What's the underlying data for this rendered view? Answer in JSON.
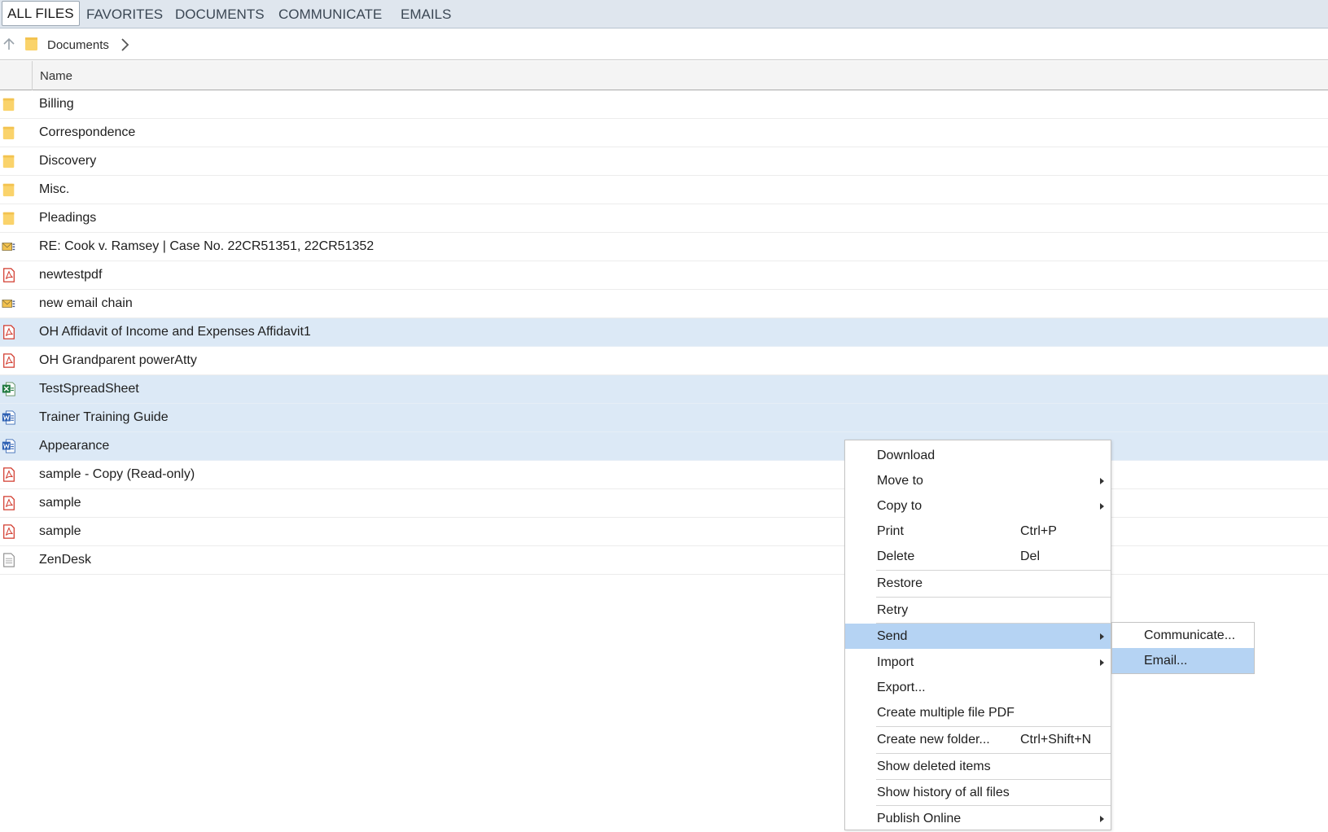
{
  "tabs": [
    {
      "label": "ALL FILES",
      "active": true
    },
    {
      "label": "FAVORITES"
    },
    {
      "label": "DOCUMENTS"
    },
    {
      "label": "COMMUNICATE"
    },
    {
      "label": "EMAILS"
    }
  ],
  "breadcrumb": {
    "folder": "Documents"
  },
  "columns": {
    "name": "Name"
  },
  "files": [
    {
      "name": "Billing",
      "icon": "folder-icon",
      "selected": false
    },
    {
      "name": "Correspondence",
      "icon": "folder-icon",
      "selected": false
    },
    {
      "name": "Discovery",
      "icon": "folder-icon",
      "selected": false
    },
    {
      "name": "Misc.",
      "icon": "folder-icon",
      "selected": false
    },
    {
      "name": "Pleadings",
      "icon": "folder-icon",
      "selected": false
    },
    {
      "name": "RE: Cook v. Ramsey | Case No. 22CR51351, 22CR51352",
      "icon": "email-file-icon",
      "selected": false
    },
    {
      "name": "newtestpdf",
      "icon": "pdf-file-icon",
      "selected": false
    },
    {
      "name": "new email chain",
      "icon": "email-file-icon",
      "selected": false
    },
    {
      "name": "OH Affidavit of Income and Expenses Affidavit1",
      "icon": "pdf-file-icon",
      "selected": true
    },
    {
      "name": "OH Grandparent powerAtty",
      "icon": "pdf-file-icon",
      "selected": false
    },
    {
      "name": "TestSpreadSheet",
      "icon": "excel-file-icon",
      "selected": true
    },
    {
      "name": "Trainer Training Guide",
      "icon": "word-file-icon",
      "selected": true
    },
    {
      "name": "Appearance",
      "icon": "word-file-icon",
      "selected": true
    },
    {
      "name": "sample - Copy (Read-only)",
      "icon": "pdf-file-icon",
      "selected": false
    },
    {
      "name": "sample",
      "icon": "pdf-file-icon",
      "selected": false
    },
    {
      "name": "sample",
      "icon": "pdf-file-icon",
      "selected": false
    },
    {
      "name": "ZenDesk",
      "icon": "text-file-icon",
      "selected": false
    }
  ],
  "context_menu": {
    "download": "Download",
    "move_to": "Move to",
    "copy_to": "Copy to",
    "print": "Print",
    "print_shortcut": "Ctrl+P",
    "delete": "Delete",
    "delete_shortcut": "Del",
    "restore": "Restore",
    "retry": "Retry",
    "send": "Send",
    "import": "Import",
    "export": "Export...",
    "create_pdf": "Create multiple file PDF",
    "create_folder": "Create new folder...",
    "create_folder_shortcut": "Ctrl+Shift+N",
    "show_deleted": "Show deleted items",
    "show_history": "Show history of all files",
    "publish_online": "Publish Online"
  },
  "send_submenu": {
    "communicate": "Communicate...",
    "email": "Email..."
  },
  "colors": {
    "selection": "#dce9f6",
    "menu_highlight": "#b5d3f3",
    "tabbar": "#dfe6ee",
    "folder": "#fad36b"
  }
}
